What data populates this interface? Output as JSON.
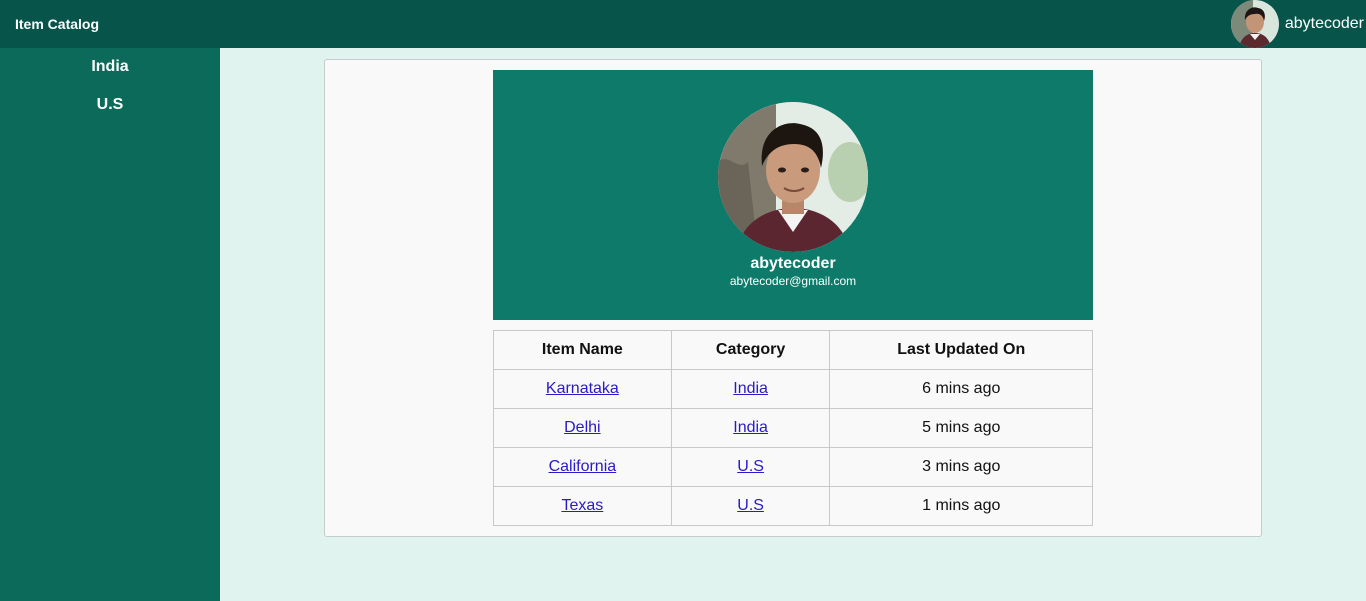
{
  "header": {
    "brand": "Item Catalog",
    "username": "abytecoder"
  },
  "sidebar": {
    "items": [
      {
        "label": "India"
      },
      {
        "label": "U.S"
      }
    ]
  },
  "profile": {
    "name": "abytecoder",
    "email": "abytecoder@gmail.com"
  },
  "table": {
    "headers": [
      "Item Name",
      "Category",
      "Last Updated On"
    ],
    "rows": [
      {
        "item": "Karnataka",
        "category": "India",
        "updated": "6 mins ago"
      },
      {
        "item": "Delhi",
        "category": "India",
        "updated": "5 mins ago"
      },
      {
        "item": "California",
        "category": "U.S",
        "updated": "3 mins ago"
      },
      {
        "item": "Texas",
        "category": "U.S",
        "updated": "1 mins ago"
      }
    ]
  },
  "colors": {
    "topbar": "#07544a",
    "sidebar": "#0b6a5a",
    "profile_banner": "#0e7b6a",
    "page_background": "#e0f3ef",
    "link": "#2a19c9"
  }
}
